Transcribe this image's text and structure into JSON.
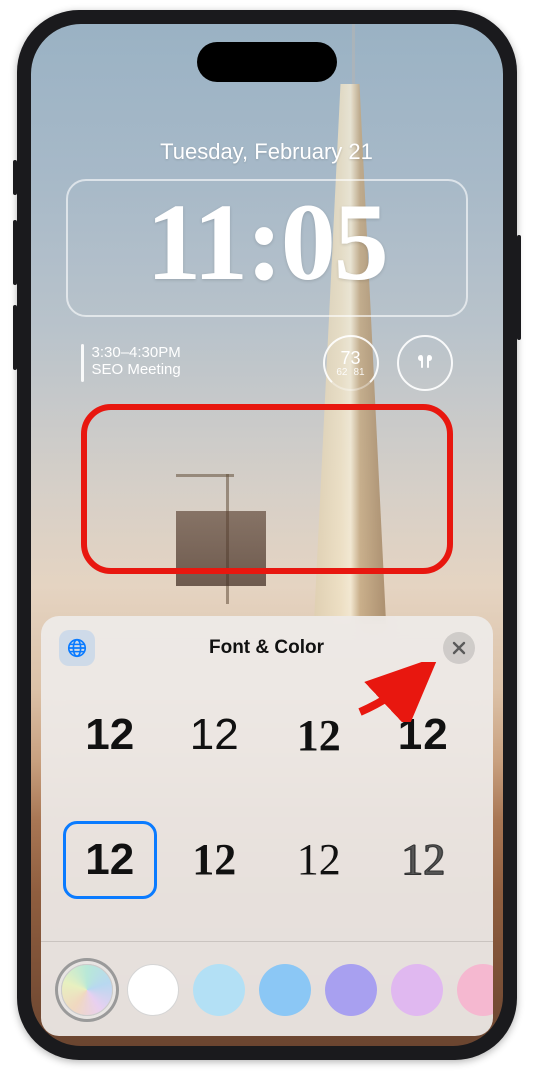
{
  "lockscreen": {
    "date": "Tuesday, February 21",
    "time": "11:05",
    "calendar": {
      "time": "3:30–4:30PM",
      "title": "SEO Meeting"
    },
    "weather": {
      "temp": "73",
      "low": "62",
      "high": "81"
    }
  },
  "panel": {
    "title": "Font & Color",
    "sample": "12",
    "fonts": [
      {
        "id": "f1",
        "selected": false
      },
      {
        "id": "f2",
        "selected": false
      },
      {
        "id": "f3",
        "selected": false
      },
      {
        "id": "f4",
        "selected": false
      },
      {
        "id": "f5",
        "selected": true
      },
      {
        "id": "f6",
        "selected": false
      },
      {
        "id": "f7",
        "selected": false
      },
      {
        "id": "f8",
        "selected": false
      }
    ],
    "colors": [
      {
        "id": "c1",
        "name": "rainbow",
        "selected": true
      },
      {
        "id": "c2",
        "name": "white",
        "selected": false
      },
      {
        "id": "c3",
        "name": "light-blue",
        "selected": false
      },
      {
        "id": "c4",
        "name": "blue",
        "selected": false
      },
      {
        "id": "c5",
        "name": "purple",
        "selected": false
      },
      {
        "id": "c6",
        "name": "lavender",
        "selected": false
      },
      {
        "id": "c7",
        "name": "pink",
        "selected": false
      }
    ]
  }
}
